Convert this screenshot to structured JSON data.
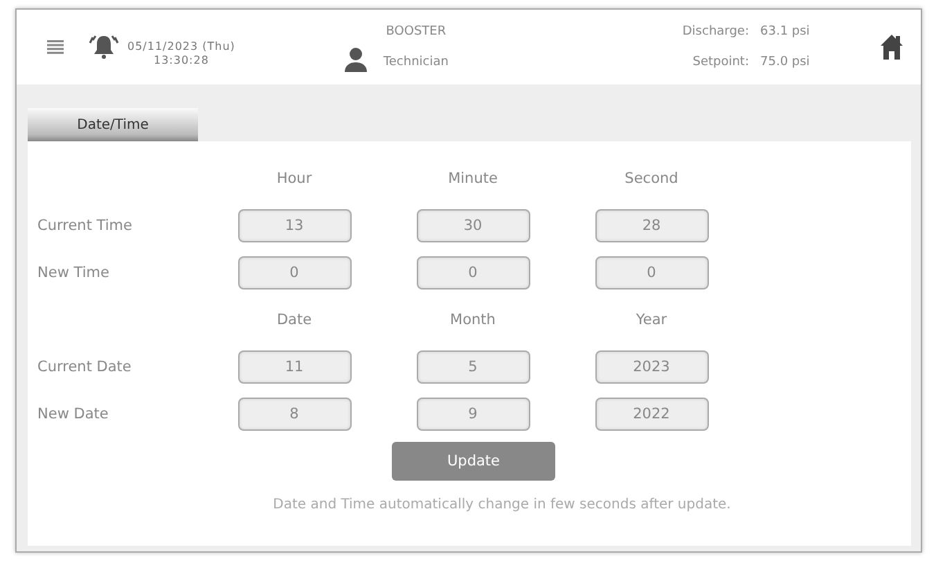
{
  "header": {
    "date": "05/11/2023 (Thu)",
    "time": "13:30:28",
    "device": "BOOSTER",
    "user": "Technician",
    "readings": [
      {
        "label": "Discharge:",
        "value": "63.1 psi"
      },
      {
        "label": "Setpoint:",
        "value": "75.0 psi"
      }
    ]
  },
  "tabs": [
    {
      "label": "Date/Time",
      "selected": true
    }
  ],
  "sections": [
    {
      "columns": [
        "Hour",
        "Minute",
        "Second"
      ],
      "rows": [
        {
          "label": "Current Time",
          "values": [
            "13",
            "30",
            "28"
          ]
        },
        {
          "label": "New Time",
          "values": [
            "0",
            "0",
            "0"
          ]
        }
      ]
    },
    {
      "columns": [
        "Date",
        "Month",
        "Year"
      ],
      "rows": [
        {
          "label": "Current Date",
          "values": [
            "11",
            "5",
            "2023"
          ]
        },
        {
          "label": "New Date",
          "values": [
            "8",
            "9",
            "2022"
          ]
        }
      ]
    }
  ],
  "update_button": "Update",
  "note": "Date and Time automatically change in few seconds after update."
}
